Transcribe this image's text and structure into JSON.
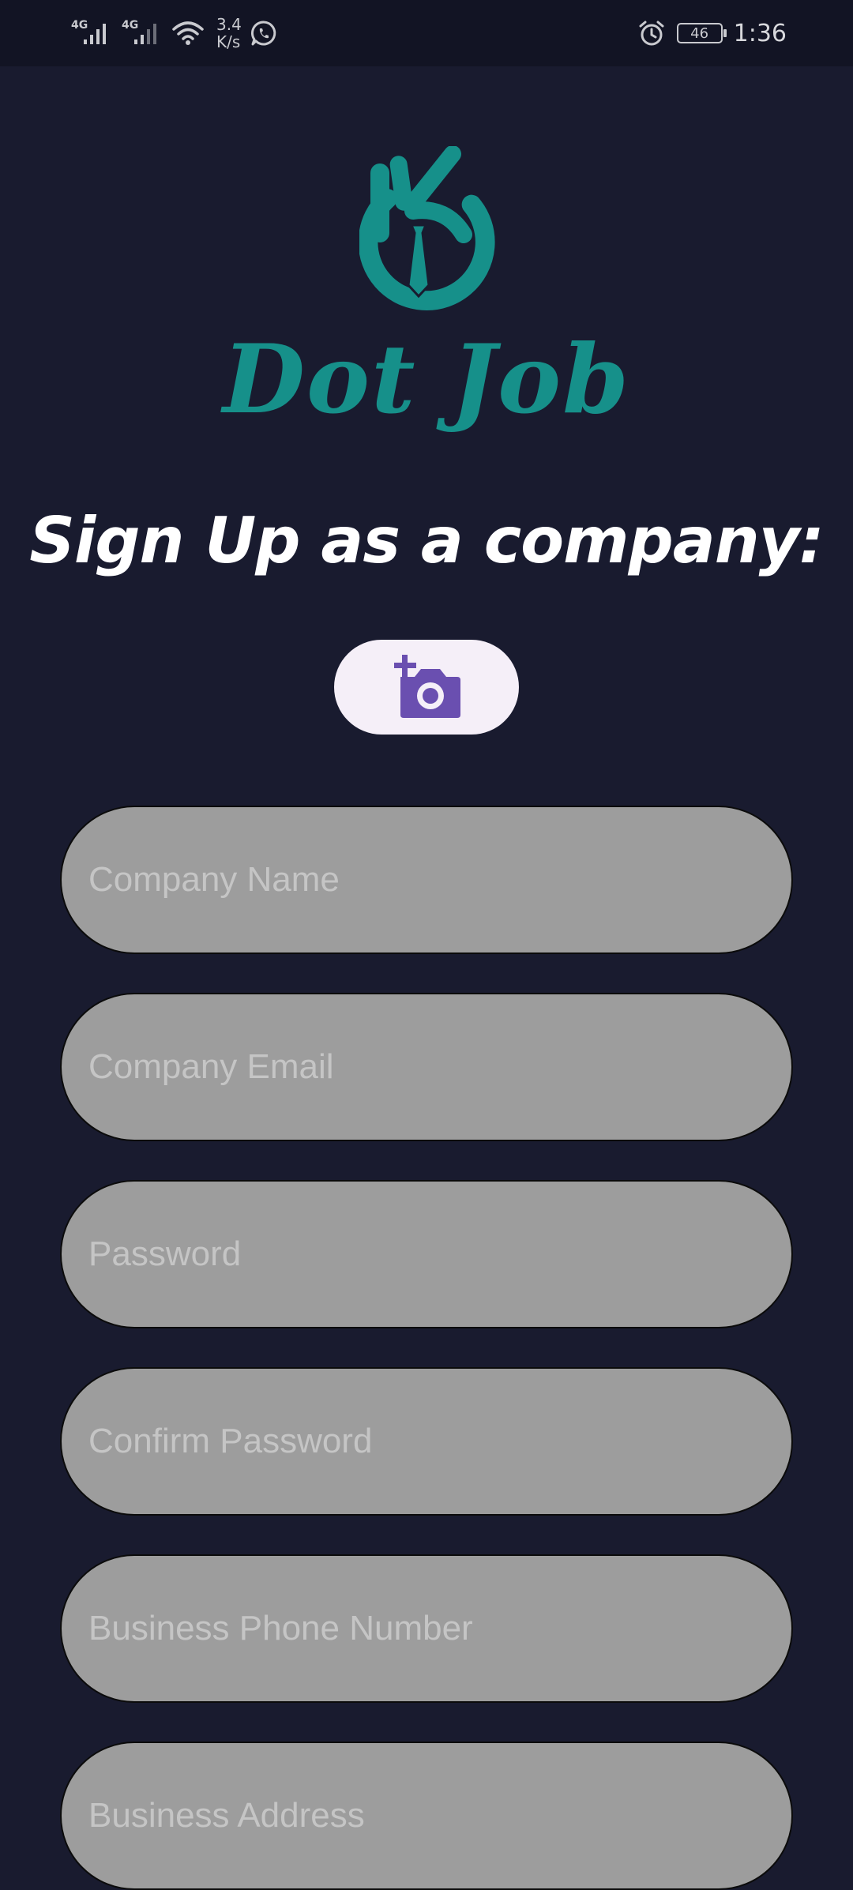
{
  "status_bar": {
    "network_1": "4G",
    "network_2": "4G",
    "speed_value": "3.4",
    "speed_unit": "K/s",
    "battery": "46",
    "time": "1:36",
    "icons": [
      "signal-icon",
      "wifi-icon",
      "whatsapp-icon",
      "alarm-icon",
      "battery-icon"
    ]
  },
  "logo": {
    "text": "Dot Job",
    "color": "#16908a"
  },
  "heading": "Sign Up as a company:",
  "photo_button": {
    "icon": "add-photo-icon",
    "icon_color": "#6a4fb0"
  },
  "form": {
    "fields": [
      {
        "placeholder": "Company Name",
        "value": ""
      },
      {
        "placeholder": "Company Email",
        "value": ""
      },
      {
        "placeholder": "Password",
        "value": ""
      },
      {
        "placeholder": "Confirm Password",
        "value": ""
      },
      {
        "placeholder": "Business Phone Number",
        "value": ""
      },
      {
        "placeholder": "Business Address",
        "value": ""
      }
    ]
  },
  "colors": {
    "background": "#191b2f",
    "field": "#9d9d9d",
    "placeholder": "#c5c5c5"
  }
}
